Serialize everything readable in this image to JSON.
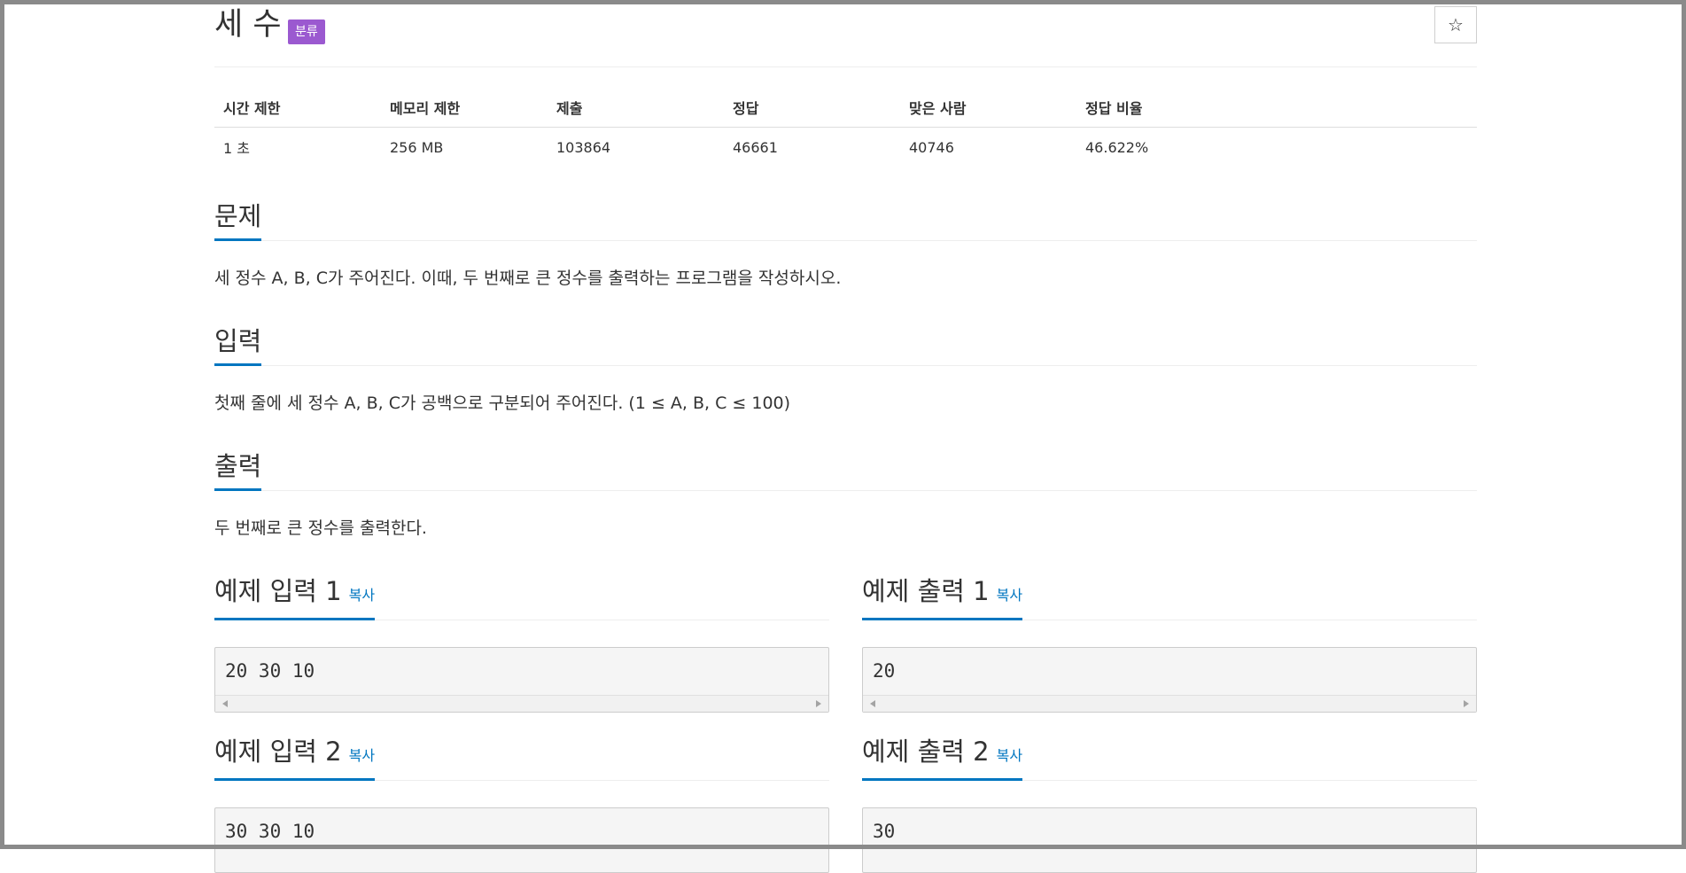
{
  "problem": {
    "title": "세 수",
    "tag_label": "분류",
    "star_icon": "☆"
  },
  "stats": {
    "headers": [
      "시간 제한",
      "메모리 제한",
      "제출",
      "정답",
      "맞은 사람",
      "정답 비율"
    ],
    "values": [
      "1 초",
      "256 MB",
      "103864",
      "46661",
      "40746",
      "46.622%"
    ]
  },
  "sections": {
    "problem": {
      "title": "문제",
      "body": "세 정수 A, B, C가 주어진다. 이때, 두 번째로 큰 정수를 출력하는 프로그램을 작성하시오."
    },
    "input": {
      "title": "입력",
      "body": "첫째 줄에 세 정수 A, B, C가 공백으로 구분되어 주어진다. (1 ≤ A, B, C ≤ 100)"
    },
    "output": {
      "title": "출력",
      "body": "두 번째로 큰 정수를 출력한다."
    }
  },
  "samples": {
    "copy_label": "복사",
    "in1": {
      "title": "예제 입력 1",
      "text": "20 30 10"
    },
    "out1": {
      "title": "예제 출력 1",
      "text": "20"
    },
    "in2": {
      "title": "예제 입력 2",
      "text": "30 30 10"
    },
    "out2": {
      "title": "예제 출력 2",
      "text": "30"
    }
  },
  "colors": {
    "accent": "#0076c0",
    "tag": "#9b59d0"
  }
}
